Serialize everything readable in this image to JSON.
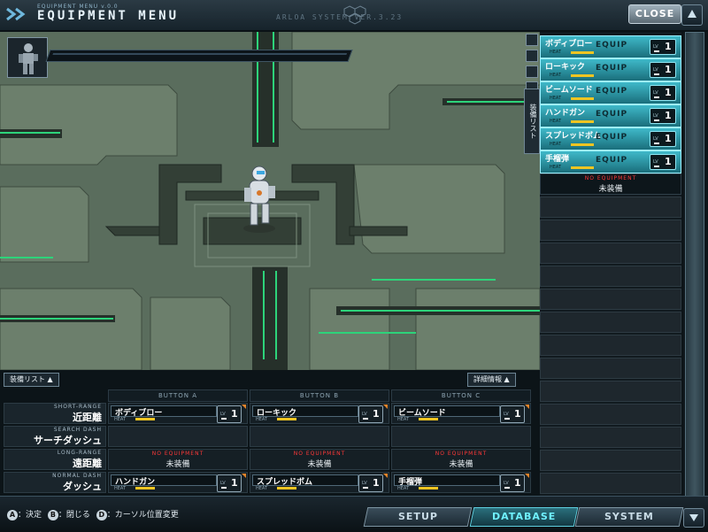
{
  "header": {
    "subtitle": "EQUIPMENT MENU v.0.0",
    "title": "EQUIPMENT MENU",
    "version": "ARLOA SYSTEM VER.3.23",
    "close_label": "CLOSE"
  },
  "right_tab": {
    "label": "装備リスト"
  },
  "right_list": {
    "slots": [
      {
        "name": "ボディブロー",
        "status": "EQUIP",
        "heat": "HEAT",
        "lv": "LV",
        "level": "1"
      },
      {
        "name": "ローキック",
        "status": "EQUIP",
        "heat": "HEAT",
        "lv": "LV",
        "level": "1"
      },
      {
        "name": "ビームソード",
        "status": "EQUIP",
        "heat": "HEAT",
        "lv": "LV",
        "level": "1"
      },
      {
        "name": "ハンドガン",
        "status": "EQUIP",
        "heat": "HEAT",
        "lv": "LV",
        "level": "1"
      },
      {
        "name": "スプレッドボム",
        "status": "EQUIP",
        "heat": "HEAT",
        "lv": "LV",
        "level": "1"
      },
      {
        "name": "手榴弾",
        "status": "EQUIP",
        "heat": "HEAT",
        "lv": "LV",
        "level": "1"
      }
    ],
    "no_equipment": {
      "en": "NO EQUIPMENT",
      "jp": "未装備"
    }
  },
  "bottom": {
    "list_tab": "装備リスト",
    "detail_tab": "詳細情報",
    "columns": [
      "BUTTON A",
      "BUTTON B",
      "BUTTON C"
    ],
    "rows": [
      {
        "en": "SHORT-RANGE",
        "jp": "近距離"
      },
      {
        "en": "SEARCH DASH",
        "jp": "サーチダッシュ"
      },
      {
        "en": "LONG-RANGE",
        "jp": "遠距離"
      },
      {
        "en": "NORMAL DASH",
        "jp": "ダッシュ"
      }
    ],
    "short_range": [
      {
        "name": "ボディブロー",
        "heat": "HEAT",
        "lv": "LV",
        "level": "1"
      },
      {
        "name": "ローキック",
        "heat": "HEAT",
        "lv": "LV",
        "level": "1"
      },
      {
        "name": "ビームソード",
        "heat": "HEAT",
        "lv": "LV",
        "level": "1"
      }
    ],
    "long_range": {
      "en": "NO EQUIPMENT",
      "jp": "未装備"
    },
    "normal_dash": [
      {
        "name": "ハンドガン",
        "heat": "HEAT",
        "lv": "LV",
        "level": "1"
      },
      {
        "name": "スプレッドボム",
        "heat": "HEAT",
        "lv": "LV",
        "level": "1"
      },
      {
        "name": "手榴弾",
        "heat": "HEAT",
        "lv": "LV",
        "level": "1"
      }
    ]
  },
  "footer": {
    "hint_a_key": "A",
    "hint_a": "：決定",
    "hint_b_key": "B",
    "hint_b": "：閉じる",
    "hint_d_key": "D",
    "hint_d": "：カーソル位置変更",
    "setup_label": "SETUP",
    "database_label": "DATABASE",
    "system_label": "SYSTEM"
  },
  "colors": {
    "accent": "#3fb9c9",
    "heat": "#f0c522",
    "warning": "#ff3838"
  }
}
